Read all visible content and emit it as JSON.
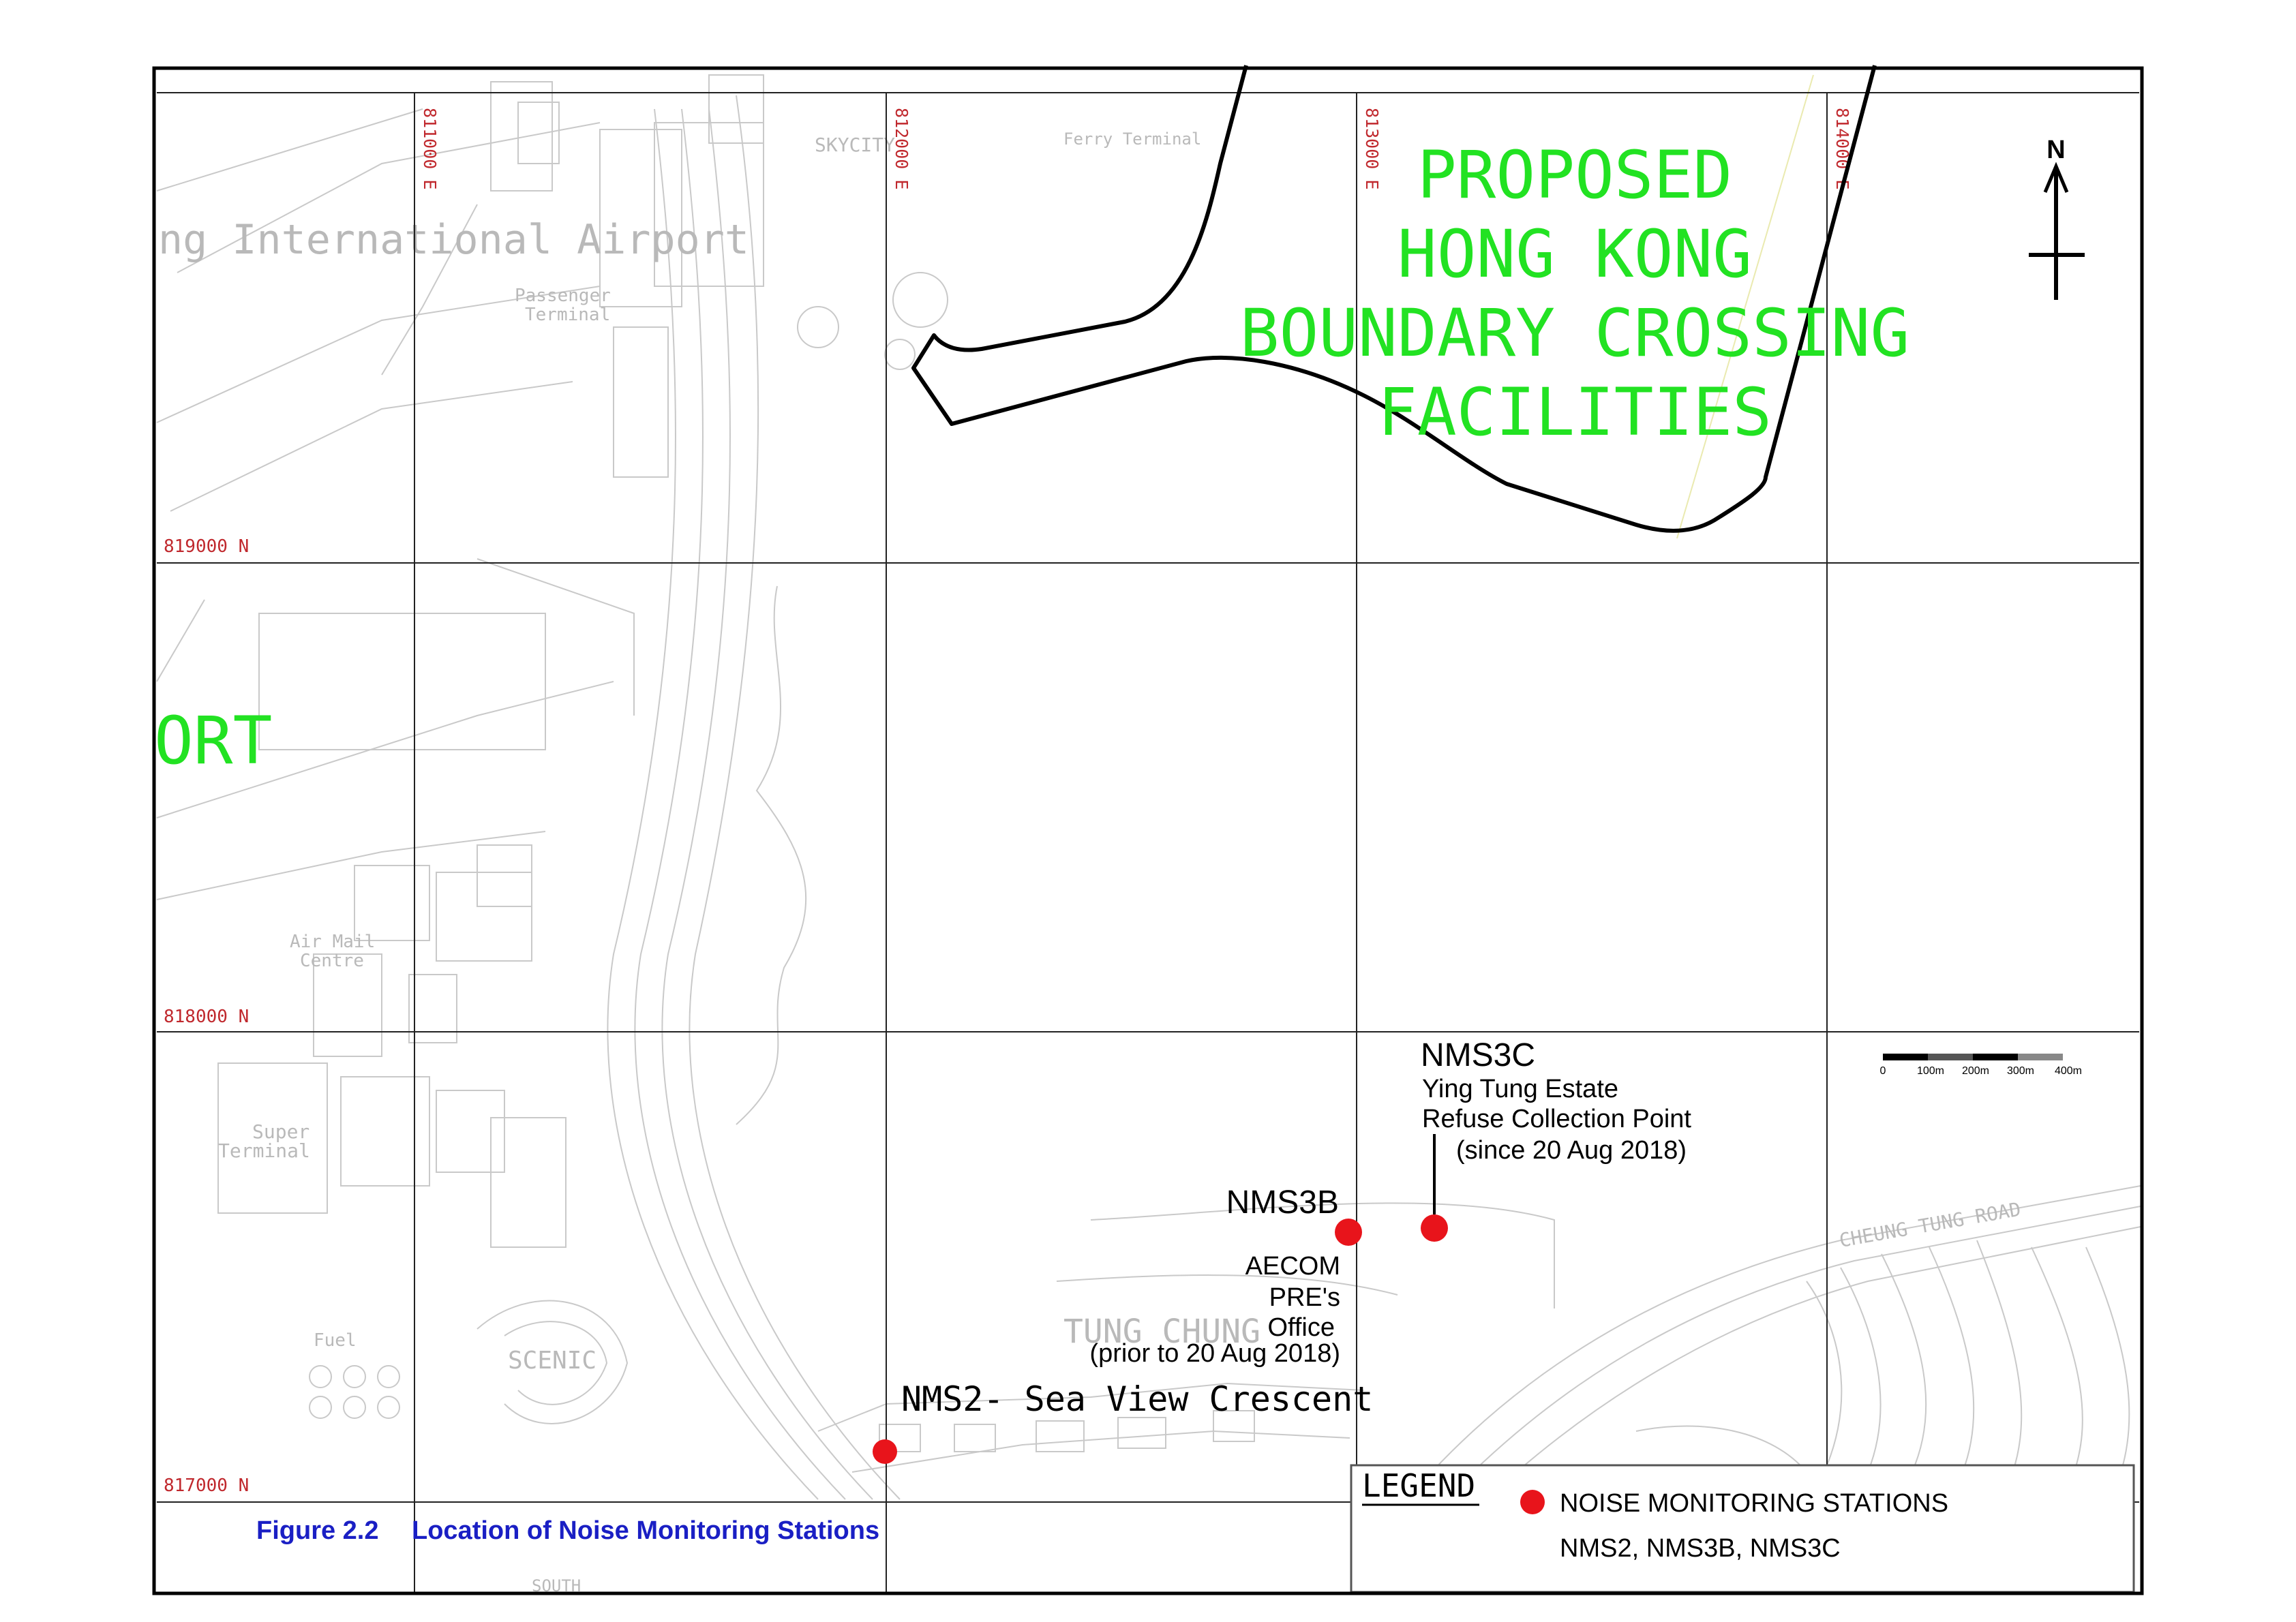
{
  "grid": {
    "easting_labels": [
      "811000 E",
      "812000 E",
      "813000 E",
      "814000 E"
    ],
    "northing_labels": [
      "819000 N",
      "818000 N",
      "817000 N"
    ]
  },
  "background_labels": {
    "airport_partial": "ng International Airport",
    "passenger_terminal": [
      "Passenger",
      "Terminal"
    ],
    "skycity": "SKYCITY",
    "ferry_terminal": "Ferry Terminal",
    "air_mail_centre": [
      "Air Mail",
      "Centre"
    ],
    "super_terminal": [
      "Super",
      "Terminal"
    ],
    "tung_chung": "TUNG CHUNG",
    "cheung_tung_road": "CHEUNG TUNG ROAD",
    "scenic": "SCENIC",
    "fuel": "Fuel",
    "south": "SOUTH",
    "airport_big": "ORT"
  },
  "project_label": [
    "PROPOSED",
    "HONG KONG",
    "BOUNDARY CROSSING",
    "FACILITIES"
  ],
  "stations": {
    "nms3c": {
      "name": "NMS3C",
      "desc": [
        "Ying Tung Estate",
        "Refuse Collection Point",
        "(since 20 Aug 2018)"
      ]
    },
    "nms3b": {
      "name": "NMS3B",
      "desc": [
        "AECOM",
        "PRE's",
        "Office",
        "(prior to 20 Aug 2018)"
      ]
    },
    "nms2": {
      "label": "NMS2- Sea View Crescent"
    }
  },
  "north_arrow": {
    "label": "N"
  },
  "scale_bar": {
    "labels": [
      "0",
      "100m",
      "200m",
      "300m",
      "400m"
    ]
  },
  "legend": {
    "title": "LEGEND",
    "item_label": "NOISE MONITORING STATIONS",
    "item_sub": "NMS2, NMS3B, NMS3C",
    "marker_color": "#e8141b"
  },
  "caption": {
    "figure_no": "Figure 2.2",
    "title": "Location of Noise Monitoring Stations"
  },
  "colors": {
    "grid_label": "#c0282d",
    "project_label": "#22e222",
    "station_marker": "#e8141b",
    "caption": "#1a1fc4"
  }
}
